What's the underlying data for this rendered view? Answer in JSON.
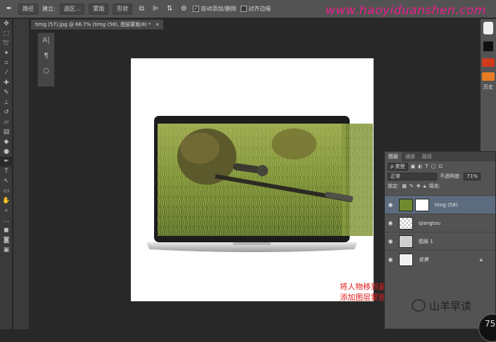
{
  "options_bar": {
    "tool_mode": "路径",
    "make_label": "建立:",
    "selection_btn": "选区...",
    "mask_btn": "蒙版",
    "shape_btn": "形状",
    "auto_add_delete": "自动添加/删除",
    "align_edges": "对齐边缘"
  },
  "watermark": "www.haoyiduanshen.com",
  "document_tab": {
    "title": "timg (57).jpg @ 66.7% (timg (58), 图层蒙版/8) *",
    "close_label": "×"
  },
  "annotation": {
    "line1": "将人物移到最上层",
    "line2": "添加图层蒙版"
  },
  "right_strip": {
    "history_label": "历史"
  },
  "layers_panel": {
    "tabs": [
      "图层",
      "通道",
      "路径"
    ],
    "filter_label": "ρ 类型",
    "blend_mode": "正常",
    "opacity_label": "不透明度:",
    "opacity_value": "71%",
    "lock_label": "锁定:",
    "fill_label": "填充:",
    "layers": [
      {
        "name": "timg (58)",
        "active": true
      },
      {
        "name": "qiangtou",
        "active": false
      },
      {
        "name": "图层 1",
        "active": false
      },
      {
        "name": "背景",
        "active": false
      }
    ]
  },
  "wechat_footer": {
    "account_name": "山羊早读"
  },
  "badge": {
    "value": "75"
  },
  "colors": {
    "app_bg": "#282828",
    "panel_bg": "#535353",
    "active_layer": "#5d6b7e",
    "watermark": "#e91e8c",
    "annotation": "#e02020"
  }
}
